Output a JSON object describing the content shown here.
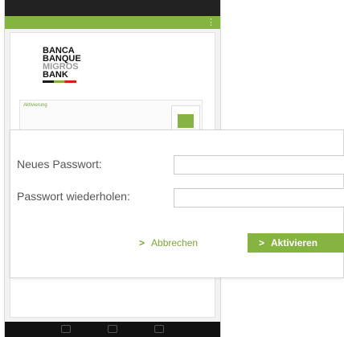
{
  "statusbar": {
    "left": "",
    "right": ""
  },
  "appbar": {
    "menu_glyph": "⋮"
  },
  "logo": {
    "line1": "BANCA",
    "line2": "BANQUE",
    "line3": "MIGROS",
    "line4": "BANK"
  },
  "card": {
    "title": "Aktivierung",
    "text": "",
    "tile_icon": "green-square-icon"
  },
  "dialog": {
    "new_password_label": "Neues Passwort:",
    "new_password_value": "",
    "repeat_password_label": "Passwort wiederholen:",
    "repeat_password_value": "",
    "cancel_label": "Abbrechen",
    "activate_label": "Aktivieren",
    "chevron_glyph": ">"
  },
  "colors": {
    "accent": "#86b441",
    "accent_text": "#7aa63b",
    "label": "#555555"
  }
}
